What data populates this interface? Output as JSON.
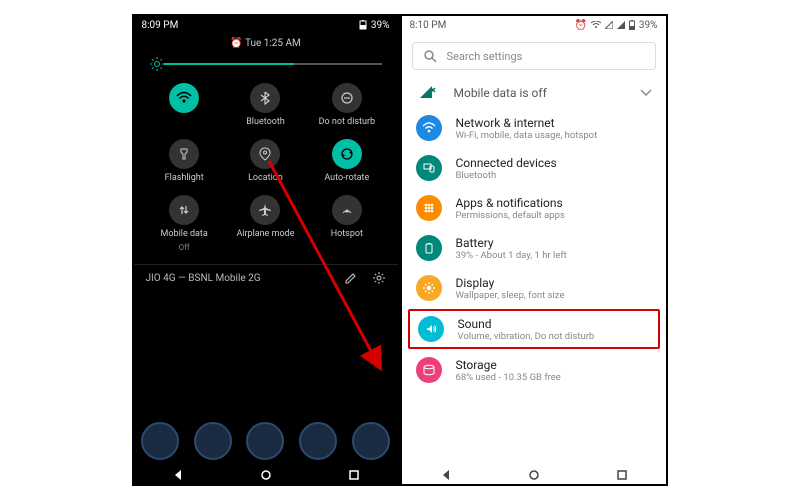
{
  "left": {
    "status": {
      "time": "8:09 PM",
      "battery": "39%"
    },
    "qs": {
      "header_time": "Tue 1:25 AM",
      "tiles": [
        {
          "label": "",
          "icon": "wifi-icon",
          "active": true,
          "blurred": true
        },
        {
          "label": "Bluetooth",
          "icon": "bluetooth-icon",
          "active": false
        },
        {
          "label": "Do not disturb",
          "icon": "dnd-icon",
          "active": false
        },
        {
          "label": "Flashlight",
          "icon": "flashlight-icon",
          "active": false
        },
        {
          "label": "Location",
          "icon": "location-icon",
          "active": false
        },
        {
          "label": "Auto-rotate",
          "icon": "autorotate-icon",
          "active": true
        },
        {
          "label": "Mobile data",
          "sub": "Off",
          "icon": "mobiledata-icon",
          "active": false
        },
        {
          "label": "Airplane mode",
          "icon": "airplane-icon",
          "active": false
        },
        {
          "label": "Hotspot",
          "icon": "hotspot-icon",
          "active": false
        }
      ],
      "footer_network": "JIO 4G — BSNL Mobile 2G"
    }
  },
  "right": {
    "status": {
      "time": "8:10 PM",
      "battery": "39%"
    },
    "search_placeholder": "Search settings",
    "banner": "Mobile data is off",
    "items": [
      {
        "title": "Network & internet",
        "sub": "Wi-Fi, mobile, data usage, hotspot",
        "icon": "wifi-icon",
        "color": "#1e88e5"
      },
      {
        "title": "Connected devices",
        "sub": "Bluetooth",
        "icon": "devices-icon",
        "color": "#00897b"
      },
      {
        "title": "Apps & notifications",
        "sub": "Permissions, default apps",
        "icon": "apps-icon",
        "color": "#fb8c00"
      },
      {
        "title": "Battery",
        "sub": "39% - About 1 day, 1 hr left",
        "icon": "battery-icon",
        "color": "#00897b"
      },
      {
        "title": "Display",
        "sub": "Wallpaper, sleep, font size",
        "icon": "display-icon",
        "color": "#f9a825"
      },
      {
        "title": "Sound",
        "sub": "Volume, vibration, Do not disturb",
        "icon": "sound-icon",
        "color": "#00bcd4",
        "highlight": true
      },
      {
        "title": "Storage",
        "sub": "68% used - 10.35 GB free",
        "icon": "storage-icon",
        "color": "#ec407a"
      }
    ]
  }
}
